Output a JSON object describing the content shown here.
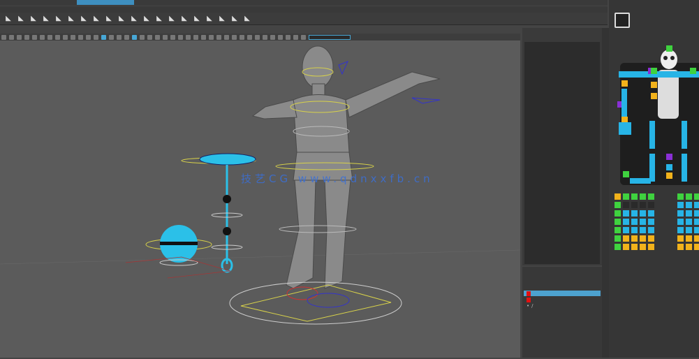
{
  "watermark": "技艺CG  www.qdnxxfb.cn",
  "colors": {
    "accent": "#47a7d6",
    "viewport_bg": "#5b5b5b",
    "control_cyan": "#2bc0e8",
    "picker_green": "#3fd23f",
    "picker_blue": "#27b4e6",
    "picker_yellow": "#f2b21b",
    "picker_purple": "#8a2fd6",
    "layer_red": "#e31010"
  },
  "shelf": {
    "icons": [
      "joint-icon",
      "ik-handle-icon",
      "bind-skin-icon",
      "paint-weights-icon",
      "curve-icon",
      "cluster-icon",
      "lattice-icon",
      "wire-icon",
      "constraint-icon",
      "aim-icon",
      "orient-icon",
      "parent-icon",
      "point-icon",
      "pole-icon",
      "scale-icon",
      "geometry-icon",
      "normal-icon",
      "tangent-icon",
      "script-icon",
      "shelf-item-icon"
    ]
  },
  "layers": {
    "rows": [
      {
        "selected": true,
        "color": "#e31010"
      },
      {
        "selected": false,
        "color": "#e31010"
      },
      {
        "selected": false,
        "color": null
      }
    ]
  }
}
